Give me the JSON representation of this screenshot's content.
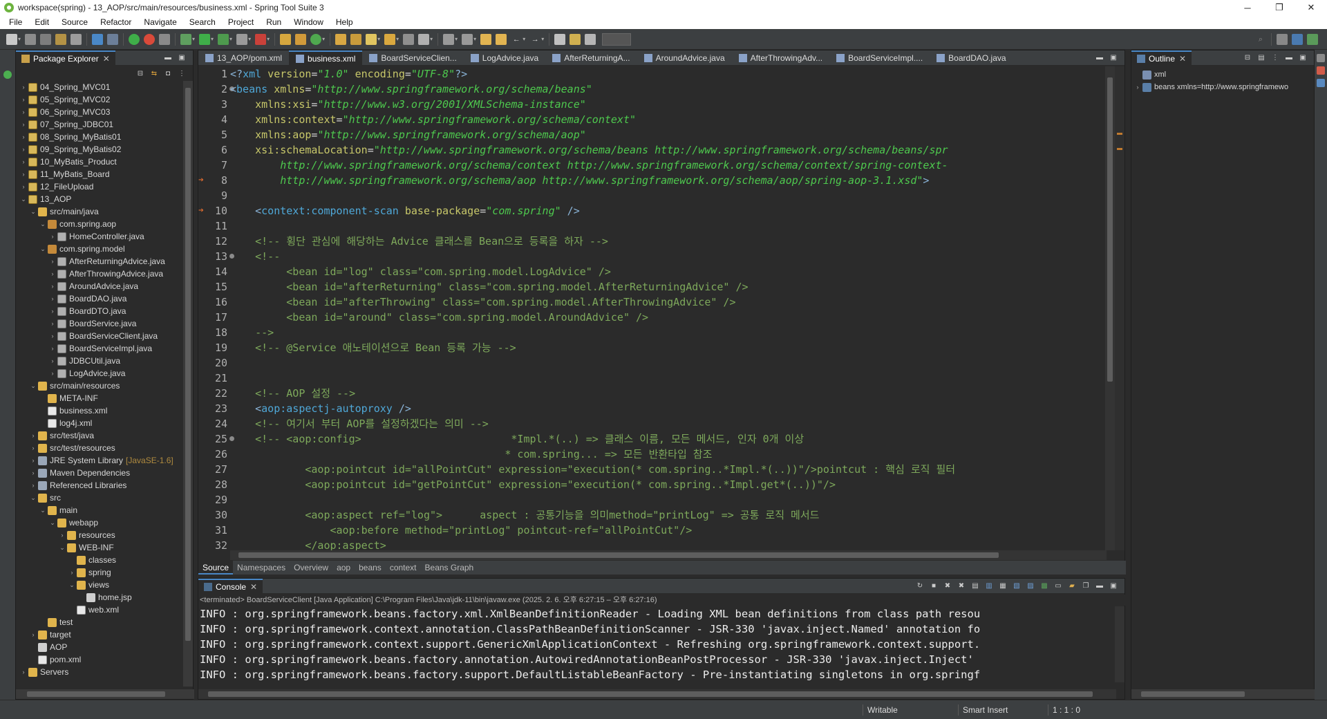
{
  "window": {
    "title": "workspace(spring) - 13_AOP/src/main/resources/business.xml - Spring Tool Suite 3",
    "minimize": "─",
    "maximize": "❐",
    "close": "✕"
  },
  "menu": [
    "File",
    "Edit",
    "Source",
    "Refactor",
    "Navigate",
    "Search",
    "Project",
    "Run",
    "Window",
    "Help"
  ],
  "package_explorer": {
    "title": "Package Explorer",
    "tree": [
      {
        "label": "04_Spring_MVC01",
        "depth": 0,
        "arrow": "›",
        "icon": "project"
      },
      {
        "label": "05_Spring_MVC02",
        "depth": 0,
        "arrow": "›",
        "icon": "project"
      },
      {
        "label": "06_Spring_MVC03",
        "depth": 0,
        "arrow": "›",
        "icon": "project"
      },
      {
        "label": "07_Spring_JDBC01",
        "depth": 0,
        "arrow": "›",
        "icon": "project"
      },
      {
        "label": "08_Spring_MyBatis01",
        "depth": 0,
        "arrow": "›",
        "icon": "project"
      },
      {
        "label": "09_Spring_MyBatis02",
        "depth": 0,
        "arrow": "›",
        "icon": "project"
      },
      {
        "label": "10_MyBatis_Product",
        "depth": 0,
        "arrow": "›",
        "icon": "project"
      },
      {
        "label": "11_MyBatis_Board",
        "depth": 0,
        "arrow": "›",
        "icon": "project"
      },
      {
        "label": "12_FileUpload",
        "depth": 0,
        "arrow": "›",
        "icon": "project"
      },
      {
        "label": "13_AOP",
        "depth": 0,
        "arrow": "⌄",
        "icon": "project"
      },
      {
        "label": "src/main/java",
        "depth": 1,
        "arrow": "⌄",
        "icon": "folder"
      },
      {
        "label": "com.spring.aop",
        "depth": 2,
        "arrow": "⌄",
        "icon": "package"
      },
      {
        "label": "HomeController.java",
        "depth": 3,
        "arrow": "›",
        "icon": "java"
      },
      {
        "label": "com.spring.model",
        "depth": 2,
        "arrow": "⌄",
        "icon": "package"
      },
      {
        "label": "AfterReturningAdvice.java",
        "depth": 3,
        "arrow": "›",
        "icon": "java"
      },
      {
        "label": "AfterThrowingAdvice.java",
        "depth": 3,
        "arrow": "›",
        "icon": "java"
      },
      {
        "label": "AroundAdvice.java",
        "depth": 3,
        "arrow": "›",
        "icon": "java"
      },
      {
        "label": "BoardDAO.java",
        "depth": 3,
        "arrow": "›",
        "icon": "java"
      },
      {
        "label": "BoardDTO.java",
        "depth": 3,
        "arrow": "›",
        "icon": "java"
      },
      {
        "label": "BoardService.java",
        "depth": 3,
        "arrow": "›",
        "icon": "java"
      },
      {
        "label": "BoardServiceClient.java",
        "depth": 3,
        "arrow": "›",
        "icon": "java"
      },
      {
        "label": "BoardServiceImpl.java",
        "depth": 3,
        "arrow": "›",
        "icon": "java"
      },
      {
        "label": "JDBCUtil.java",
        "depth": 3,
        "arrow": "›",
        "icon": "java"
      },
      {
        "label": "LogAdvice.java",
        "depth": 3,
        "arrow": "›",
        "icon": "java"
      },
      {
        "label": "src/main/resources",
        "depth": 1,
        "arrow": "⌄",
        "icon": "folder"
      },
      {
        "label": "META-INF",
        "depth": 2,
        "arrow": "",
        "icon": "folder"
      },
      {
        "label": "business.xml",
        "depth": 2,
        "arrow": "",
        "icon": "xml"
      },
      {
        "label": "log4j.xml",
        "depth": 2,
        "arrow": "",
        "icon": "xml"
      },
      {
        "label": "src/test/java",
        "depth": 1,
        "arrow": "›",
        "icon": "folder"
      },
      {
        "label": "src/test/resources",
        "depth": 1,
        "arrow": "›",
        "icon": "folder"
      },
      {
        "label": "JRE System Library",
        "extra": "[JavaSE-1.6]",
        "depth": 1,
        "arrow": "›",
        "icon": "lib"
      },
      {
        "label": "Maven Dependencies",
        "depth": 1,
        "arrow": "›",
        "icon": "lib"
      },
      {
        "label": "Referenced Libraries",
        "depth": 1,
        "arrow": "›",
        "icon": "lib"
      },
      {
        "label": "src",
        "depth": 1,
        "arrow": "⌄",
        "icon": "folder"
      },
      {
        "label": "main",
        "depth": 2,
        "arrow": "⌄",
        "icon": "folder"
      },
      {
        "label": "webapp",
        "depth": 3,
        "arrow": "⌄",
        "icon": "folder"
      },
      {
        "label": "resources",
        "depth": 4,
        "arrow": "›",
        "icon": "folder"
      },
      {
        "label": "WEB-INF",
        "depth": 4,
        "arrow": "⌄",
        "icon": "folder"
      },
      {
        "label": "classes",
        "depth": 5,
        "arrow": "",
        "icon": "folder"
      },
      {
        "label": "spring",
        "depth": 5,
        "arrow": "›",
        "icon": "folder"
      },
      {
        "label": "views",
        "depth": 5,
        "arrow": "⌄",
        "icon": "folder"
      },
      {
        "label": "home.jsp",
        "depth": 6,
        "arrow": "",
        "icon": "file"
      },
      {
        "label": "web.xml",
        "depth": 5,
        "arrow": "",
        "icon": "xml"
      },
      {
        "label": "test",
        "depth": 2,
        "arrow": "",
        "icon": "folder"
      },
      {
        "label": "target",
        "depth": 1,
        "arrow": "›",
        "icon": "folder"
      },
      {
        "label": "AOP",
        "depth": 1,
        "arrow": "",
        "icon": "file"
      },
      {
        "label": "pom.xml",
        "depth": 1,
        "arrow": "",
        "icon": "xml"
      },
      {
        "label": "Servers",
        "depth": 0,
        "arrow": "›",
        "icon": "folder"
      }
    ]
  },
  "editor": {
    "tabs": [
      {
        "label": "13_AOP/pom.xml",
        "active": false
      },
      {
        "label": "business.xml",
        "active": true
      },
      {
        "label": "BoardServiceClien...",
        "active": false
      },
      {
        "label": "LogAdvice.java",
        "active": false
      },
      {
        "label": "AfterReturningA...",
        "active": false
      },
      {
        "label": "AroundAdvice.java",
        "active": false
      },
      {
        "label": "AfterThrowingAdv...",
        "active": false
      },
      {
        "label": "BoardServiceImpl....",
        "active": false
      },
      {
        "label": "BoardDAO.java",
        "active": false
      }
    ],
    "lines": [
      {
        "n": "1",
        "mark": "",
        "dot": false,
        "segs": [
          [
            "punc",
            "<?"
          ],
          [
            "tag",
            "xml"
          ],
          [
            "attr",
            " version"
          ],
          [
            "text",
            "="
          ],
          [
            "val",
            "\"1.0\""
          ],
          [
            "attr",
            " encoding"
          ],
          [
            "text",
            "="
          ],
          [
            "val",
            "\"UTF-8\""
          ],
          [
            "punc",
            "?>"
          ]
        ]
      },
      {
        "n": "2",
        "mark": "",
        "dot": true,
        "segs": [
          [
            "punc",
            "<"
          ],
          [
            "tag",
            "beans"
          ],
          [
            "attr",
            " xmlns"
          ],
          [
            "text",
            "="
          ],
          [
            "val",
            "\"http://www.springframework.org/schema/beans\""
          ]
        ]
      },
      {
        "n": "3",
        "mark": "",
        "dot": false,
        "segs": [
          [
            "attr",
            "    xmlns:xsi"
          ],
          [
            "text",
            "="
          ],
          [
            "val",
            "\"http://www.w3.org/2001/XMLSchema-instance\""
          ]
        ]
      },
      {
        "n": "4",
        "mark": "",
        "dot": false,
        "segs": [
          [
            "attr",
            "    xmlns:context"
          ],
          [
            "text",
            "="
          ],
          [
            "val",
            "\"http://www.springframework.org/schema/context\""
          ]
        ]
      },
      {
        "n": "5",
        "mark": "",
        "dot": false,
        "segs": [
          [
            "attr",
            "    xmlns:aop"
          ],
          [
            "text",
            "="
          ],
          [
            "val",
            "\"http://www.springframework.org/schema/aop\""
          ]
        ]
      },
      {
        "n": "6",
        "mark": "",
        "dot": false,
        "segs": [
          [
            "attr",
            "    xsi:schemaLocation"
          ],
          [
            "text",
            "="
          ],
          [
            "val",
            "\"http://www.springframework.org/schema/beans http://www.springframework.org/schema/beans/spr"
          ]
        ]
      },
      {
        "n": "7",
        "mark": "",
        "dot": false,
        "segs": [
          [
            "val",
            "        http://www.springframework.org/schema/context http://www.springframework.org/schema/context/spring-context-"
          ]
        ]
      },
      {
        "n": "8",
        "mark": "➔",
        "dot": false,
        "segs": [
          [
            "val",
            "        http://www.springframework.org/schema/aop http://www.springframework.org/schema/aop/spring-aop-3.1.xsd\""
          ],
          [
            "punc",
            ">"
          ]
        ]
      },
      {
        "n": "9",
        "mark": "",
        "dot": false,
        "segs": [
          [
            "text",
            ""
          ]
        ]
      },
      {
        "n": "10",
        "mark": "➔",
        "dot": false,
        "segs": [
          [
            "punc",
            "    <"
          ],
          [
            "tag",
            "context:component-scan"
          ],
          [
            "attr",
            " base-package"
          ],
          [
            "text",
            "="
          ],
          [
            "val",
            "\"com.spring\""
          ],
          [
            "punc",
            " />"
          ]
        ]
      },
      {
        "n": "11",
        "mark": "",
        "dot": false,
        "segs": [
          [
            "text",
            ""
          ]
        ]
      },
      {
        "n": "12",
        "mark": "",
        "dot": false,
        "segs": [
          [
            "com",
            "    <!-- 횡단 관심에 해당하는 Advice 클래스를 Bean으로 등록을 하자 -->"
          ]
        ]
      },
      {
        "n": "13",
        "mark": "",
        "dot": true,
        "segs": [
          [
            "com",
            "    <!--"
          ]
        ]
      },
      {
        "n": "14",
        "mark": "",
        "dot": false,
        "segs": [
          [
            "com",
            "         <bean id=\"log\" class=\"com.spring.model.LogAdvice\" />"
          ]
        ]
      },
      {
        "n": "15",
        "mark": "",
        "dot": false,
        "segs": [
          [
            "com",
            "         <bean id=\"afterReturning\" class=\"com.spring.model.AfterReturningAdvice\" />"
          ]
        ]
      },
      {
        "n": "16",
        "mark": "",
        "dot": false,
        "segs": [
          [
            "com",
            "         <bean id=\"afterThrowing\" class=\"com.spring.model.AfterThrowingAdvice\" />"
          ]
        ]
      },
      {
        "n": "17",
        "mark": "",
        "dot": false,
        "segs": [
          [
            "com",
            "         <bean id=\"around\" class=\"com.spring.model.AroundAdvice\" />"
          ]
        ]
      },
      {
        "n": "18",
        "mark": "",
        "dot": false,
        "segs": [
          [
            "com",
            "    -->"
          ]
        ]
      },
      {
        "n": "19",
        "mark": "",
        "dot": false,
        "segs": [
          [
            "com",
            "    <!-- @Service 애노테이션으로 Bean 등록 가능 -->"
          ]
        ]
      },
      {
        "n": "20",
        "mark": "",
        "dot": false,
        "segs": [
          [
            "text",
            ""
          ]
        ]
      },
      {
        "n": "21",
        "mark": "",
        "dot": false,
        "segs": [
          [
            "text",
            ""
          ]
        ]
      },
      {
        "n": "22",
        "mark": "",
        "dot": false,
        "segs": [
          [
            "com",
            "    <!-- AOP 설정 -->"
          ]
        ]
      },
      {
        "n": "23",
        "mark": "",
        "dot": false,
        "segs": [
          [
            "punc",
            "    <"
          ],
          [
            "tag",
            "aop:aspectj-autoproxy"
          ],
          [
            "punc",
            " />"
          ]
        ]
      },
      {
        "n": "24",
        "mark": "",
        "dot": false,
        "segs": [
          [
            "com",
            "    <!-- 여기서 부터 AOP를 설정하겠다는 의미 -->"
          ]
        ]
      },
      {
        "n": "25",
        "mark": "",
        "dot": true,
        "segs": [
          [
            "com",
            "    <!-- <aop:config>                        *Impl.*(..) => 클래스 이름, 모든 메서드, 인자 0개 이상"
          ]
        ]
      },
      {
        "n": "26",
        "mark": "",
        "dot": false,
        "segs": [
          [
            "com",
            "                                            * com.spring... => 모든 반환타입 참조"
          ]
        ]
      },
      {
        "n": "27",
        "mark": "",
        "dot": false,
        "segs": [
          [
            "com",
            "            <aop:pointcut id=\"allPointCut\" expression=\"execution(* com.spring..*Impl.*(..))\"/>pointcut : 핵심 로직 필터"
          ]
        ]
      },
      {
        "n": "28",
        "mark": "",
        "dot": false,
        "segs": [
          [
            "com",
            "            <aop:pointcut id=\"getPointCut\" expression=\"execution(* com.spring..*Impl.get*(..))\"/>"
          ]
        ]
      },
      {
        "n": "29",
        "mark": "",
        "dot": false,
        "segs": [
          [
            "text",
            ""
          ]
        ]
      },
      {
        "n": "30",
        "mark": "",
        "dot": false,
        "segs": [
          [
            "com",
            "            <aop:aspect ref=\"log\">      aspect : 공통기능을 의미method=\"printLog\" => 공통 로직 메서드"
          ]
        ]
      },
      {
        "n": "31",
        "mark": "",
        "dot": false,
        "segs": [
          [
            "com",
            "                <aop:before method=\"printLog\" pointcut-ref=\"allPointCut\"/>"
          ]
        ]
      },
      {
        "n": "32",
        "mark": "",
        "dot": false,
        "segs": [
          [
            "com",
            "            </aop:aspect>"
          ]
        ]
      }
    ],
    "sub_tabs": [
      "Source",
      "Namespaces",
      "Overview",
      "aop",
      "beans",
      "context",
      "Beans Graph"
    ]
  },
  "console": {
    "title": "Console",
    "status": "<terminated> BoardServiceClient [Java Application] C:\\Program Files\\Java\\jdk-11\\bin\\javaw.exe  (2025. 2. 6. 오후 6:27:15 – 오후 6:27:16)",
    "lines": [
      "INFO : org.springframework.beans.factory.xml.XmlBeanDefinitionReader - Loading XML bean definitions from class path resou",
      "INFO : org.springframework.context.annotation.ClassPathBeanDefinitionScanner - JSR-330 'javax.inject.Named' annotation fo",
      "INFO : org.springframework.context.support.GenericXmlApplicationContext - Refreshing org.springframework.context.support.",
      "INFO : org.springframework.beans.factory.annotation.AutowiredAnnotationBeanPostProcessor - JSR-330 'javax.inject.Inject'",
      "INFO : org.springframework.beans.factory.support.DefaultListableBeanFactory - Pre-instantiating singletons in org.springf"
    ]
  },
  "outline": {
    "title": "Outline",
    "items": [
      {
        "label": "xml",
        "depth": 0,
        "arrow": ""
      },
      {
        "label": "beans xmlns=http://www.springframewo",
        "depth": 0,
        "arrow": "›"
      }
    ]
  },
  "statusbar": {
    "writable": "Writable",
    "insert_mode": "Smart Insert",
    "position": "1 : 1 : 0"
  },
  "colors": {
    "accent": "#4a88c7",
    "xml_tag": "#4fa8d8",
    "xml_attr": "#c8c86a",
    "xml_value": "#4ec94e",
    "xml_comment": "#7ea95b"
  }
}
